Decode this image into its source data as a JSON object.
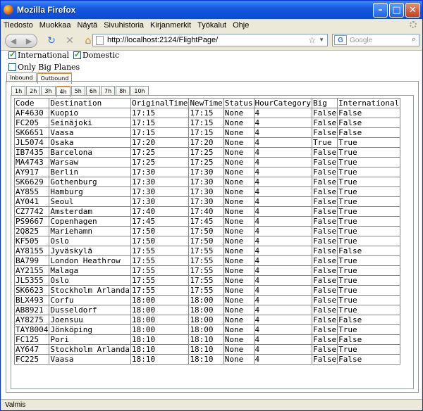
{
  "window": {
    "title": "Mozilla Firefox"
  },
  "menu": [
    "Tiedosto",
    "Muokkaa",
    "Näytä",
    "Sivuhistoria",
    "Kirjanmerkit",
    "Työkalut",
    "Ohje"
  ],
  "address": {
    "url": "http://localhost:2124/FlightPage/"
  },
  "search": {
    "placeholder": "Google"
  },
  "filters": {
    "international": {
      "label": "International",
      "checked": true
    },
    "domestic": {
      "label": "Domestic",
      "checked": true
    },
    "big_planes": {
      "label": "Only Big Planes",
      "checked": false
    }
  },
  "direction_tabs": [
    "Inbound",
    "Outbound"
  ],
  "direction_selected": "Outbound",
  "hour_tabs": [
    "1h",
    "2h",
    "3h",
    "4h",
    "5h",
    "6h",
    "7h",
    "8h",
    "10h"
  ],
  "hour_selected": "4h",
  "table": {
    "columns": [
      "Code",
      "Destination",
      "OriginalTime",
      "NewTime",
      "Status",
      "HourCategory",
      "Big",
      "International"
    ],
    "rows": [
      [
        "AF4630",
        "Kuopio",
        "17:15",
        "17:15",
        "None",
        "4",
        "False",
        "False"
      ],
      [
        "FC205",
        "Seinäjoki",
        "17:15",
        "17:15",
        "None",
        "4",
        "False",
        "False"
      ],
      [
        "SK6651",
        "Vaasa",
        "17:15",
        "17:15",
        "None",
        "4",
        "False",
        "False"
      ],
      [
        "JL5074",
        "Osaka",
        "17:20",
        "17:20",
        "None",
        "4",
        "True",
        "True"
      ],
      [
        "IB7435",
        "Barcelona",
        "17:25",
        "17:25",
        "None",
        "4",
        "False",
        "True"
      ],
      [
        "MA4743",
        "Warsaw",
        "17:25",
        "17:25",
        "None",
        "4",
        "False",
        "True"
      ],
      [
        "AY917",
        "Berlin",
        "17:30",
        "17:30",
        "None",
        "4",
        "False",
        "True"
      ],
      [
        "SK6629",
        "Gothenburg",
        "17:30",
        "17:30",
        "None",
        "4",
        "False",
        "True"
      ],
      [
        "AY855",
        "Hamburg",
        "17:30",
        "17:30",
        "None",
        "4",
        "False",
        "True"
      ],
      [
        "AY041",
        "Seoul",
        "17:30",
        "17:30",
        "None",
        "4",
        "False",
        "True"
      ],
      [
        "CZ7742",
        "Amsterdam",
        "17:40",
        "17:40",
        "None",
        "4",
        "False",
        "True"
      ],
      [
        "PS9667",
        "Copenhagen",
        "17:45",
        "17:45",
        "None",
        "4",
        "False",
        "True"
      ],
      [
        "2Q825",
        "Mariehamn",
        "17:50",
        "17:50",
        "None",
        "4",
        "False",
        "True"
      ],
      [
        "KF505",
        "Oslo",
        "17:50",
        "17:50",
        "None",
        "4",
        "False",
        "True"
      ],
      [
        "AY8155",
        "Jyväskylä",
        "17:55",
        "17:55",
        "None",
        "4",
        "False",
        "False"
      ],
      [
        "BA799",
        "London Heathrow",
        "17:55",
        "17:55",
        "None",
        "4",
        "False",
        "True"
      ],
      [
        "AY2155",
        "Malaga",
        "17:55",
        "17:55",
        "None",
        "4",
        "False",
        "True"
      ],
      [
        "JL5355",
        "Oslo",
        "17:55",
        "17:55",
        "None",
        "4",
        "False",
        "True"
      ],
      [
        "SK6623",
        "Stockholm Arlanda",
        "17:55",
        "17:55",
        "None",
        "4",
        "False",
        "True"
      ],
      [
        "BLX493",
        "Corfu",
        "18:00",
        "18:00",
        "None",
        "4",
        "False",
        "True"
      ],
      [
        "AB8921",
        "Dusseldorf",
        "18:00",
        "18:00",
        "None",
        "4",
        "False",
        "True"
      ],
      [
        "AY8275",
        "Joensuu",
        "18:00",
        "18:00",
        "None",
        "4",
        "False",
        "False"
      ],
      [
        "TAY8004",
        "Jönköping",
        "18:00",
        "18:00",
        "None",
        "4",
        "False",
        "True"
      ],
      [
        "FC125",
        "Pori",
        "18:10",
        "18:10",
        "None",
        "4",
        "False",
        "False"
      ],
      [
        "AY647",
        "Stockholm Arlanda",
        "18:10",
        "18:10",
        "None",
        "4",
        "False",
        "True"
      ],
      [
        "FC225",
        "Vaasa",
        "18:10",
        "18:10",
        "None",
        "4",
        "False",
        "False"
      ]
    ]
  },
  "status": "Valmis"
}
